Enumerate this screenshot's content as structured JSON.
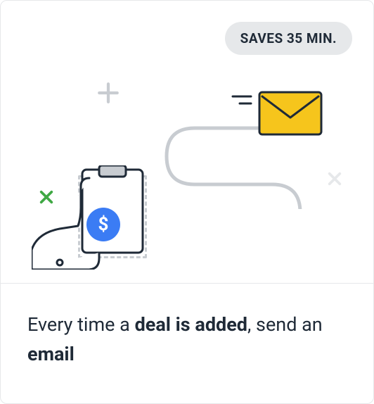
{
  "badge": {
    "label": "SAVES 35 MIN."
  },
  "caption": {
    "pre": "Every time a ",
    "bold1": "deal is added",
    "mid": ", send an ",
    "bold2": "email"
  },
  "icons": {
    "coin_glyph": "$"
  }
}
